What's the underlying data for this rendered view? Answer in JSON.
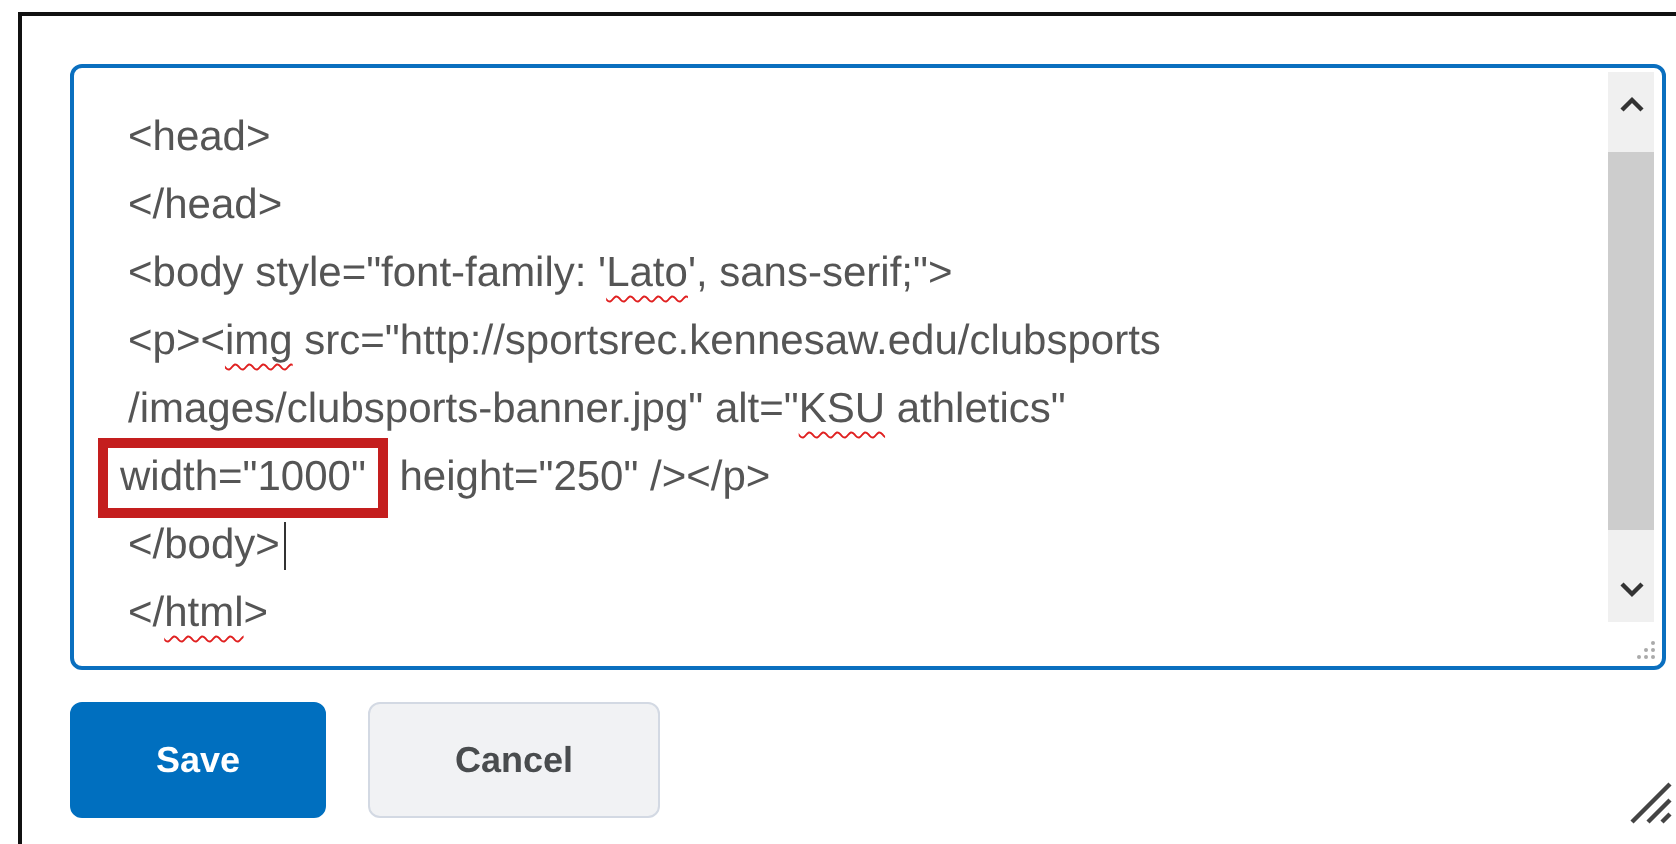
{
  "editor": {
    "lines": [
      {
        "segments": [
          {
            "text": "<head>",
            "misspelled": false,
            "highlighted": false
          }
        ],
        "cursor": false
      },
      {
        "segments": [
          {
            "text": "</head>",
            "misspelled": false,
            "highlighted": false
          }
        ],
        "cursor": false
      },
      {
        "segments": [
          {
            "text": "<body style=\"font-family: '",
            "misspelled": false,
            "highlighted": false
          },
          {
            "text": "Lato",
            "misspelled": true,
            "highlighted": false
          },
          {
            "text": "', sans-serif;\">",
            "misspelled": false,
            "highlighted": false
          }
        ],
        "cursor": false
      },
      {
        "segments": [
          {
            "text": "<p><",
            "misspelled": false,
            "highlighted": false
          },
          {
            "text": "img",
            "misspelled": true,
            "highlighted": false
          },
          {
            "text": " src=\"http://sportsrec.kennesaw.edu/clubsports",
            "misspelled": false,
            "highlighted": false
          }
        ],
        "cursor": false
      },
      {
        "segments": [
          {
            "text": "/images/clubsports-banner.jpg\" alt=\"",
            "misspelled": false,
            "highlighted": false
          },
          {
            "text": "KSU",
            "misspelled": true,
            "highlighted": false
          },
          {
            "text": " athletics\"",
            "misspelled": false,
            "highlighted": false
          }
        ],
        "cursor": false
      },
      {
        "segments": [
          {
            "text": "width=\"1000\"",
            "misspelled": false,
            "highlighted": true
          },
          {
            "text": " height=\"250\" /></p>",
            "misspelled": false,
            "highlighted": false
          }
        ],
        "cursor": false
      },
      {
        "segments": [
          {
            "text": "</body>",
            "misspelled": false,
            "highlighted": false
          }
        ],
        "cursor": true
      },
      {
        "segments": [
          {
            "text": "</",
            "misspelled": false,
            "highlighted": false
          },
          {
            "text": "html",
            "misspelled": true,
            "highlighted": false
          },
          {
            "text": ">",
            "misspelled": false,
            "highlighted": false
          }
        ],
        "cursor": false
      }
    ]
  },
  "buttons": [
    {
      "label": "Save",
      "kind": "primary"
    },
    {
      "label": "Cancel",
      "kind": "secondary"
    }
  ]
}
